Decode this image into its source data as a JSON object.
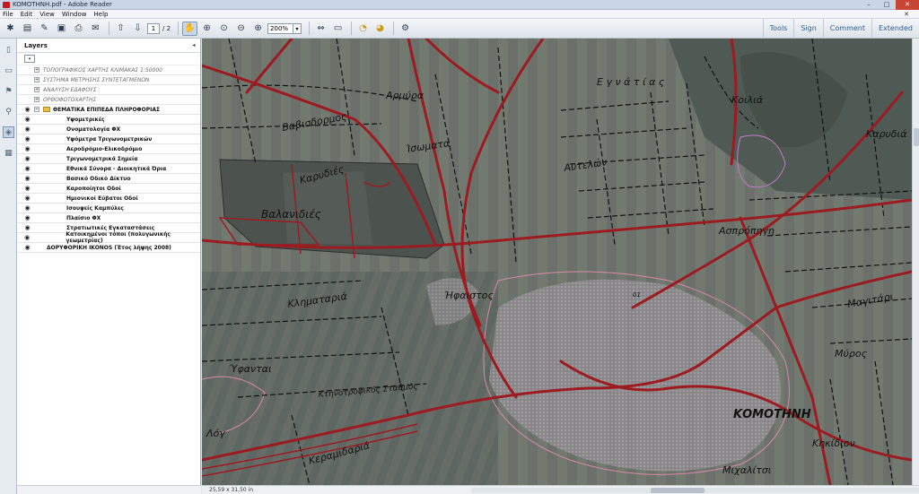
{
  "window": {
    "title": "KOMOTHNH.pdf - Adobe Reader",
    "controls": [
      "–",
      "□",
      "✕"
    ]
  },
  "menubar": {
    "items": [
      "File",
      "Edit",
      "View",
      "Window",
      "Help"
    ],
    "close_glyph": "✕"
  },
  "toolbar": {
    "current_page": "1",
    "total_pages": "/ 2",
    "zoom": "200%",
    "zoom_arrow": "▾",
    "right_items": [
      "Tools",
      "Sign",
      "Comment",
      "Extended"
    ]
  },
  "layers_panel": {
    "title": "Layers",
    "collapse_glyph": "◂",
    "options_glyph": "▾",
    "rows": [
      {
        "label": "ΤΟΠΟΓΡΑΦΙΚΟΣ ΧΑΡΤΗΣ ΚΛΙΜΑΚΑΣ 1:50000",
        "visible": false,
        "expandable": true,
        "style": "hidden"
      },
      {
        "label": "ΣΥΣΤΗΜΑ ΜΕΤΡΗΣΗΣ ΣΥΝΤΕΤΑΓΜΕΝΩΝ",
        "visible": false,
        "expandable": true,
        "style": "hidden"
      },
      {
        "label": "ΑΝΑΛΥΣΗ ΕΔΑΦΟΥΣ",
        "visible": false,
        "expandable": true,
        "style": "hidden"
      },
      {
        "label": "ΟΡΘΟΦΩΤΟΧΑΡΤΗΣ",
        "visible": false,
        "expandable": true,
        "style": "hidden"
      },
      {
        "label": "ΘΕΜΑΤΙΚΑ ΕΠΙΠΕΔΑ ΠΛΗΡΟΦΟΡΙΑΣ",
        "visible": true,
        "expandable": true,
        "style": "folder"
      },
      {
        "label": "Υψομετρικές",
        "visible": true,
        "style": "child"
      },
      {
        "label": "Ονοματολογία ΦΧ",
        "visible": true,
        "style": "child"
      },
      {
        "label": "Υψόμετρα Τριγωνομετρικών",
        "visible": true,
        "style": "child"
      },
      {
        "label": "Αεροδρόμιο-Ελικοδρόμιο",
        "visible": true,
        "style": "child"
      },
      {
        "label": "Τριγωνομετρικά Σημεία",
        "visible": true,
        "style": "child"
      },
      {
        "label": "Εθνικά Σύνορα - Διοικητικά Όρια",
        "visible": true,
        "style": "child"
      },
      {
        "label": "Βασικό Οδικό Δίκτυο",
        "visible": true,
        "style": "child"
      },
      {
        "label": "Καροποίητοι Οδοί",
        "visible": true,
        "style": "child"
      },
      {
        "label": "Ημιονικοί Εύβατοι Οδοί",
        "visible": true,
        "style": "child"
      },
      {
        "label": "Ισουψείς Καμπύλες",
        "visible": true,
        "style": "child"
      },
      {
        "label": "Πλαίσιο ΦΧ",
        "visible": true,
        "style": "child"
      },
      {
        "label": "Στρατιωτικές Εγκαταστάσεις",
        "visible": true,
        "style": "child"
      },
      {
        "label": "Κατοικημένοι τόποι (πολυγωνικής γεωμετρίας)",
        "visible": true,
        "style": "child"
      },
      {
        "label": "ΔΟΡΥΦΟΡΙΚΗ IKONOS (Έτος λήψης 2008)",
        "visible": true,
        "style": "bold"
      }
    ]
  },
  "map": {
    "labels": [
      "Ε γ ν ά τ ί α ς",
      "Αρμύρα",
      "Κοιλιά",
      "Καρυδιά",
      "Βαβισδορμος",
      "Ίσωματα",
      "Καρυδιές",
      "Αυτελών",
      "Βαλανιδιές",
      "Ασπρόπηγη",
      "Ήφαιστος",
      "Κληματαριά",
      "Μαγιτάρι",
      "Ύφανται",
      "Κτηνοτροφικός Σταθμός",
      "ΚΟΜΟΤΗΝΗ",
      "Μύρος",
      "Κηκίδιον",
      "Κεραμιδαριά",
      "Μιχαλίτσι",
      "Λόγ",
      "01"
    ]
  },
  "status": {
    "page_size": "25,59 x 31,50 in"
  }
}
